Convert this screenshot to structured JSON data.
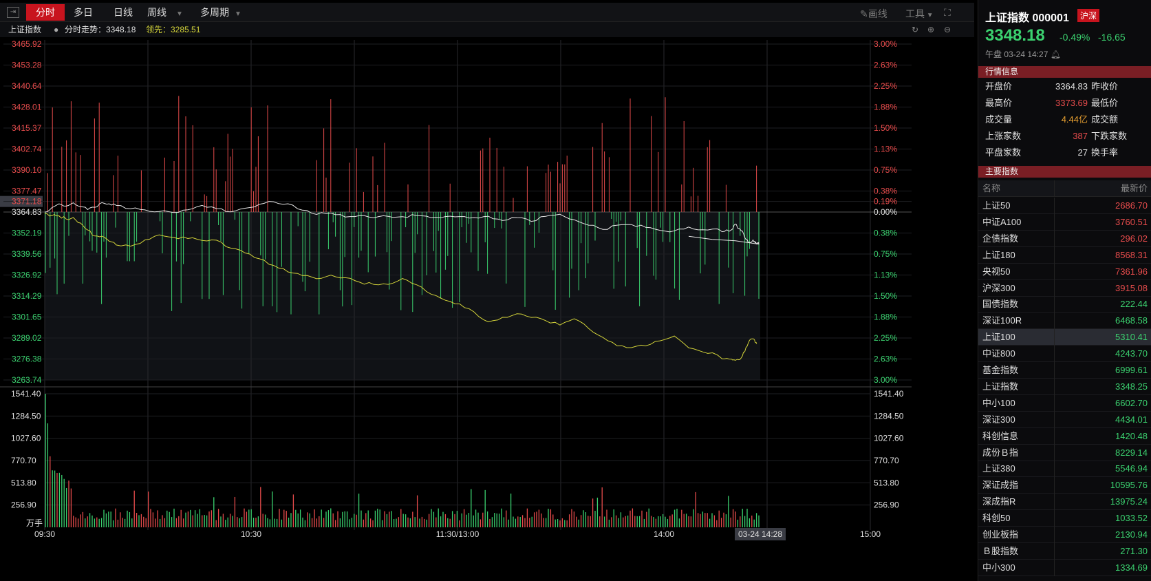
{
  "toolbar": {
    "tabs": [
      {
        "label": "分时",
        "active": true
      },
      {
        "label": "多日"
      },
      {
        "label": "日线"
      },
      {
        "label": "周线"
      },
      {
        "label": "多周期"
      }
    ],
    "draw_label": "画线",
    "tools_label": "工具"
  },
  "subheader": {
    "name": "上证指数",
    "trend_label": "分时走势：3348.18",
    "lead_label": "领先：3285.51"
  },
  "chart_data": {
    "type": "line",
    "x_ticks": [
      "09:30",
      "10:30",
      "11:30/13:00",
      "14:00",
      "15:00"
    ],
    "cursor_label": "03-24 14:28",
    "price_axis_left": [
      "3465.92",
      "3453.28",
      "3440.64",
      "3428.01",
      "3415.37",
      "3402.74",
      "3390.10",
      "3377.47",
      "3371.18",
      "3364.83",
      "3352.19",
      "3339.56",
      "3326.92",
      "3314.29",
      "3301.65",
      "3289.02",
      "3276.38",
      "3263.74"
    ],
    "price_axis_right": [
      "3.00%",
      "2.63%",
      "2.25%",
      "1.88%",
      "1.50%",
      "1.13%",
      "0.75%",
      "0.38%",
      "0.19%",
      "0.00%",
      "0.38%",
      "0.75%",
      "1.13%",
      "1.50%",
      "1.88%",
      "2.25%",
      "2.63%",
      "3.00%"
    ],
    "ylim": [
      3263.74,
      3465.92
    ],
    "prev_close": 3364.83,
    "volume_axis": [
      "1541.40",
      "1284.50",
      "1027.60",
      "770.70",
      "513.80",
      "256.90"
    ],
    "volume_unit": "万手",
    "series": [
      {
        "name": "分时走势",
        "color": "#e8e8e8",
        "values": [
          3364.8,
          3367.5,
          3369.8,
          3368.4,
          3370.4,
          3368.1,
          3366.3,
          3367.7,
          3370.5,
          3369.8,
          3368.8,
          3366.8,
          3366.1,
          3365.1,
          3364.5,
          3366.2,
          3368.8,
          3366.9,
          3364.9,
          3367.1,
          3369.5,
          3371.0,
          3369.8,
          3366.0,
          3363.4,
          3364.2,
          3361.8,
          3362.7,
          3361.3,
          3362.2,
          3362.0,
          3362.7,
          3361.4,
          3362.1,
          3362.1,
          3361.4,
          3362.3,
          3359.7,
          3361.4,
          3359.2,
          3362.2,
          3363.5,
          3360.2,
          3356.9,
          3354.4,
          3356.9,
          3357.3,
          3355.6,
          3353.8,
          3353.5,
          3355.8,
          3354.2,
          3354.7,
          3353.2,
          3354.2,
          3357.6,
          3354.9,
          3353.4,
          3348.3,
          3346.6,
          3348.0,
          3346.2,
          3345.6,
          3346.1,
          3345.5,
          3350.2
        ],
        "x_frac": [
          0.0,
          0.01,
          0.02,
          0.03,
          0.04,
          0.05,
          0.06,
          0.07,
          0.08,
          0.09,
          0.1,
          0.12,
          0.14,
          0.16,
          0.18,
          0.2,
          0.22,
          0.24,
          0.26,
          0.28,
          0.3,
          0.32,
          0.34,
          0.36,
          0.38,
          0.4,
          0.42,
          0.44,
          0.46,
          0.48,
          0.5,
          0.52,
          0.54,
          0.56,
          0.58,
          0.6,
          0.62,
          0.64,
          0.66,
          0.68,
          0.7,
          0.72,
          0.74,
          0.76,
          0.78,
          0.8,
          0.82,
          0.84,
          0.86,
          0.88,
          0.9,
          0.92,
          0.94,
          0.95,
          0.96,
          0.965,
          0.97,
          0.975,
          0.98,
          0.985,
          0.99,
          0.993,
          0.995,
          0.997,
          0.998,
          0.9
        ]
      },
      {
        "name": "领先",
        "color": "#d4d43a",
        "values": [
          3364.0,
          3362.7,
          3362.5,
          3360.6,
          3361.5,
          3358.2,
          3354.0,
          3350.4,
          3350.3,
          3347.3,
          3345.0,
          3344.3,
          3348.0,
          3351.1,
          3349.6,
          3348.9,
          3347.7,
          3347.9,
          3343.1,
          3340.2,
          3336.7,
          3332.7,
          3328.8,
          3326.6,
          3324.7,
          3326.9,
          3325.3,
          3322.6,
          3321.2,
          3321.3,
          3324.8,
          3321.0,
          3315.4,
          3311.7,
          3309.5,
          3304.7,
          3298.7,
          3301.5,
          3303.6,
          3301.4,
          3299.5,
          3296.8,
          3300.6,
          3294.8,
          3289.4,
          3284.3,
          3283.2,
          3284.3,
          3287.3,
          3290.2,
          3283.1,
          3280.6,
          3278.8,
          3276.5,
          3276.3,
          3275.6,
          3275.9,
          3278.1,
          3283.2,
          3287.6,
          3288.5,
          3286.4,
          3285.5
        ],
        "x_frac": [
          0.0,
          0.01,
          0.02,
          0.03,
          0.04,
          0.05,
          0.06,
          0.07,
          0.08,
          0.09,
          0.1,
          0.12,
          0.14,
          0.16,
          0.18,
          0.2,
          0.22,
          0.24,
          0.26,
          0.28,
          0.3,
          0.32,
          0.34,
          0.36,
          0.38,
          0.4,
          0.42,
          0.44,
          0.46,
          0.48,
          0.5,
          0.52,
          0.54,
          0.56,
          0.58,
          0.6,
          0.62,
          0.64,
          0.66,
          0.68,
          0.7,
          0.72,
          0.74,
          0.76,
          0.78,
          0.8,
          0.82,
          0.84,
          0.86,
          0.88,
          0.9,
          0.92,
          0.94,
          0.95,
          0.96,
          0.965,
          0.97,
          0.975,
          0.98,
          0.985,
          0.99,
          0.993,
          0.995
        ]
      }
    ]
  },
  "quote": {
    "title": "上证指数 000001",
    "badge": "沪深",
    "price": "3348.18",
    "pct": "-0.49%",
    "chg": "-16.65",
    "time": "午盘   03-24   14:27"
  },
  "info": {
    "section_title": "行情信息",
    "rows": [
      {
        "label": "开盘价",
        "value": "3364.83",
        "color": "#e0e0e0",
        "label2": "昨收价"
      },
      {
        "label": "最高价",
        "value": "3373.69",
        "color": "#e84c4c",
        "label2": "最低价"
      },
      {
        "label": "成交量",
        "value": "4.44亿",
        "color": "#e8a030",
        "label2": "成交额"
      },
      {
        "label": "上涨家数",
        "value": "387",
        "color": "#e84c4c",
        "label2": "下跌家数"
      },
      {
        "label": "平盘家数",
        "value": "27",
        "color": "#e0e0e0",
        "label2": "换手率"
      }
    ]
  },
  "indices": {
    "section_title": "主要指数",
    "col_name": "名称",
    "col_price": "最新价",
    "rows": [
      {
        "name": "上证50",
        "value": "2686.70",
        "color": "#e84c4c"
      },
      {
        "name": "中证A100",
        "value": "3760.51",
        "color": "#e84c4c"
      },
      {
        "name": "企债指数",
        "value": "296.02",
        "color": "#e84c4c"
      },
      {
        "name": "上证180",
        "value": "8568.31",
        "color": "#e84c4c"
      },
      {
        "name": "央视50",
        "value": "7361.96",
        "color": "#e84c4c"
      },
      {
        "name": "沪深300",
        "value": "3915.08",
        "color": "#e84c4c"
      },
      {
        "name": "国债指数",
        "value": "222.44",
        "color": "#3bd16f"
      },
      {
        "name": "深证100R",
        "value": "6468.58",
        "color": "#3bd16f"
      },
      {
        "name": "上证100",
        "value": "5310.41",
        "color": "#3bd16f",
        "selected": true
      },
      {
        "name": "中证800",
        "value": "4243.70",
        "color": "#3bd16f"
      },
      {
        "name": "基金指数",
        "value": "6999.61",
        "color": "#3bd16f"
      },
      {
        "name": "上证指数",
        "value": "3348.25",
        "color": "#3bd16f"
      },
      {
        "name": "中小100",
        "value": "6602.70",
        "color": "#3bd16f"
      },
      {
        "name": "深证300",
        "value": "4434.01",
        "color": "#3bd16f"
      },
      {
        "name": "科创信息",
        "value": "1420.48",
        "color": "#3bd16f"
      },
      {
        "name": "成份Ｂ指",
        "value": "8229.14",
        "color": "#3bd16f"
      },
      {
        "name": "上证380",
        "value": "5546.94",
        "color": "#3bd16f"
      },
      {
        "name": "深证成指",
        "value": "10595.76",
        "color": "#3bd16f"
      },
      {
        "name": "深成指R",
        "value": "13975.24",
        "color": "#3bd16f"
      },
      {
        "name": "科创50",
        "value": "1033.52",
        "color": "#3bd16f"
      },
      {
        "name": "创业板指",
        "value": "2130.94",
        "color": "#3bd16f"
      },
      {
        "name": "Ｂ股指数",
        "value": "271.30",
        "color": "#3bd16f"
      },
      {
        "name": "中小300",
        "value": "1334.69",
        "color": "#3bd16f"
      }
    ]
  },
  "colors": {
    "up": "#e84c4c",
    "down": "#3bd16f",
    "accent": "#c8141e"
  }
}
